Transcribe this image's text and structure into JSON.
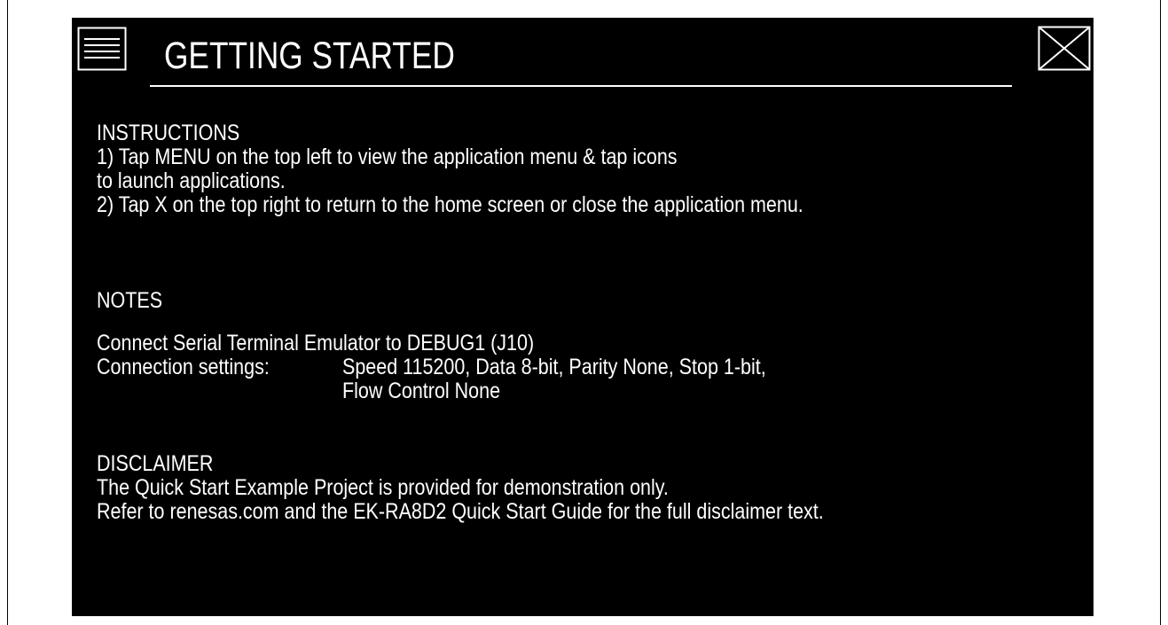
{
  "window": {
    "title": "GETTING STARTED"
  },
  "icons": {
    "menu": "menu-icon",
    "close": "close-icon"
  },
  "instructions": {
    "heading": "INSTRUCTIONS",
    "line1": "1) Tap MENU on the top left to view the application menu & tap icons",
    "line2": "to launch applications.",
    "line3": "2) Tap X on the top right to return to the home screen or close the application menu."
  },
  "notes": {
    "heading": "NOTES",
    "line1": "Connect Serial Terminal Emulator to DEBUG1 (J10)",
    "settings_label": "Connection settings:",
    "settings_value1": "Speed 115200, Data 8-bit, Parity None, Stop 1-bit,",
    "settings_value2": "Flow Control None"
  },
  "disclaimer": {
    "heading": "DISCLAIMER",
    "line1": "The Quick Start Example Project is provided for demonstration only.",
    "line2": "Refer to renesas.com and the EK-RA8D2 Quick Start Guide for the full disclaimer text."
  },
  "colors": {
    "background": "#000000",
    "foreground": "#ffffff"
  }
}
